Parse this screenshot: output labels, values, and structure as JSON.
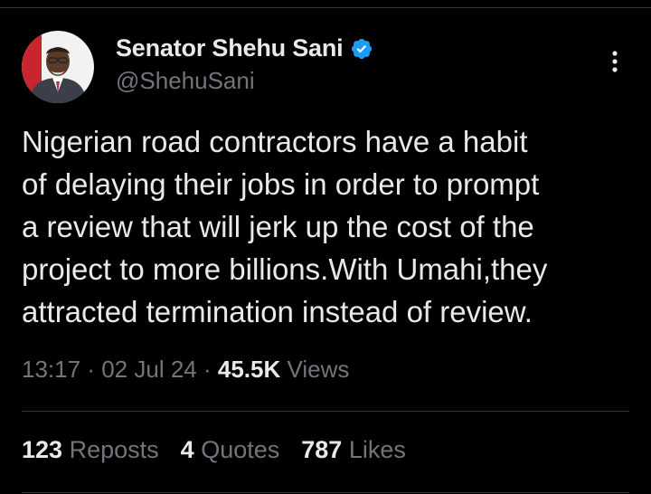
{
  "author": {
    "display_name": "Senator Shehu Sani",
    "handle": "@ShehuSani",
    "avatar_icon": "profile-photo",
    "verified_icon": "verified-badge-icon"
  },
  "more_icon": "more-options-icon",
  "tweet": {
    "text": "Nigerian road contractors have a habit\nof delaying their jobs in order to prompt\na review that will jerk up the cost of the\nproject to more billions.With Umahi,they\nattracted termination instead of review."
  },
  "meta": {
    "time": "13:17",
    "sep1": "·",
    "date": "02 Jul 24",
    "sep2": "·",
    "views_count": "45.5K",
    "views_label": "Views"
  },
  "stats": {
    "reposts_count": "123",
    "reposts_label": "Reposts",
    "quotes_count": "4",
    "quotes_label": "Quotes",
    "likes_count": "787",
    "likes_label": "Likes"
  },
  "colors": {
    "background": "#000000",
    "primary_text": "#e7e9ea",
    "secondary_text": "#71767b",
    "verified_blue": "#1d9bf0",
    "divider": "#2f3336"
  }
}
